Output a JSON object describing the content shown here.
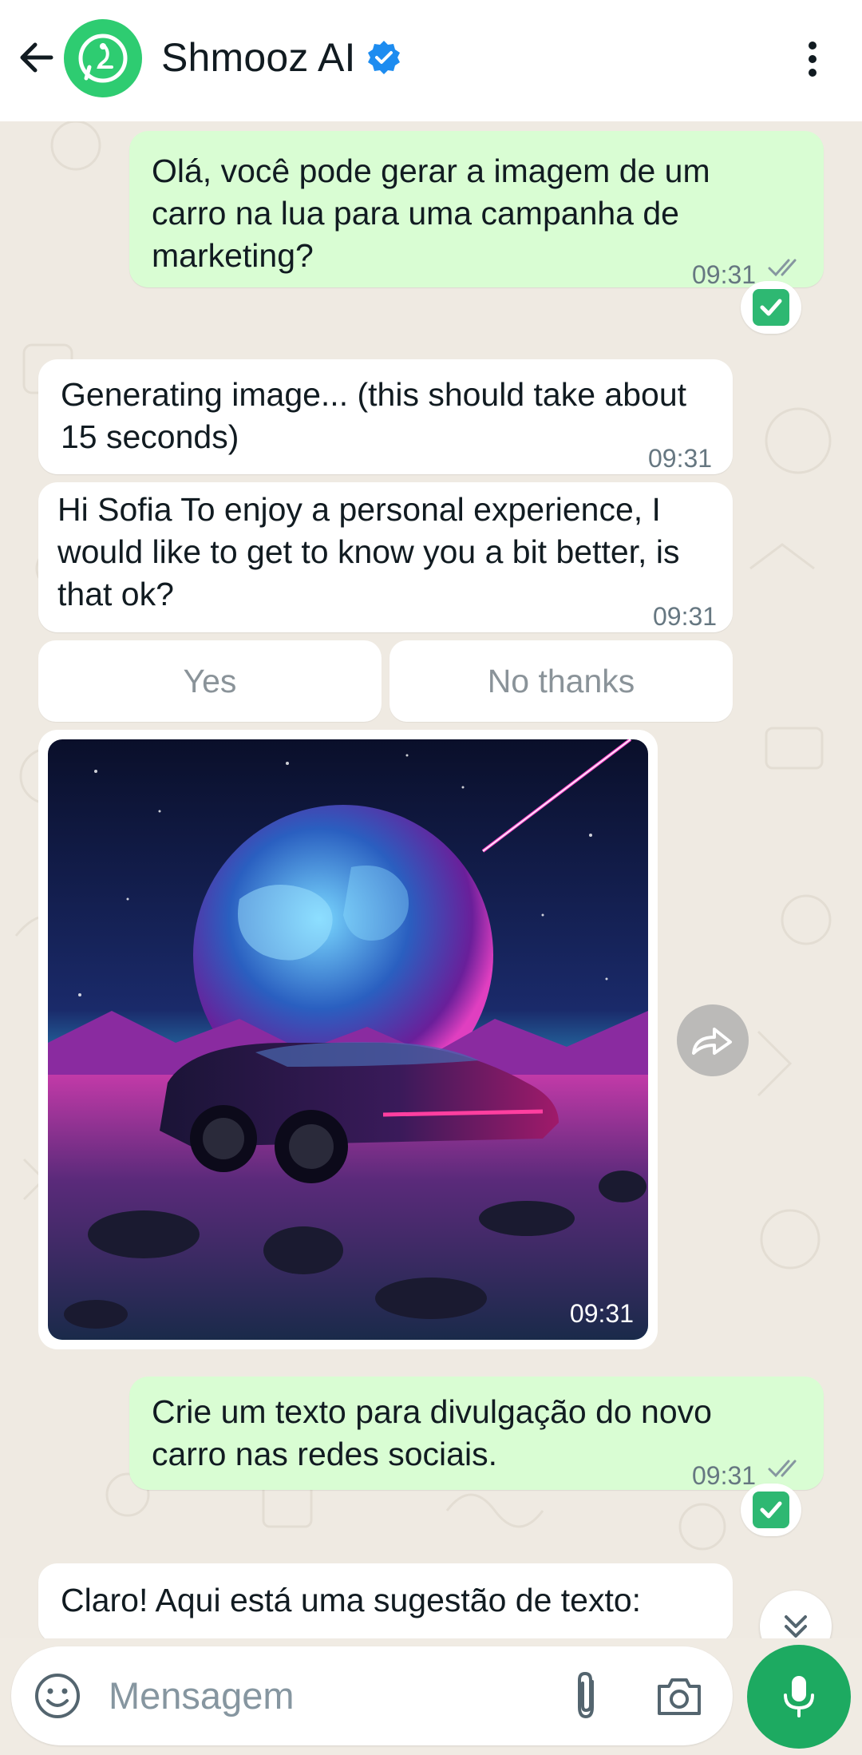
{
  "header": {
    "title": "Shmooz AI",
    "back_icon": "arrow-left-icon",
    "avatar_icon": "whatsapp-avatar-icon",
    "verified_icon": "verified-badge-icon",
    "menu_icon": "more-vert-icon"
  },
  "messages": [
    {
      "direction": "outgoing",
      "text": "Olá, você pode gerar a imagem de um carro na lua para uma campanha de marketing?",
      "time": "09:31",
      "status": "read",
      "reaction": "check-mark-icon"
    },
    {
      "direction": "incoming",
      "text": "Generating image... (this should take about 15 seconds)",
      "time": "09:31"
    },
    {
      "direction": "incoming",
      "text": "Hi Sofia To enjoy a personal experience, I would like to get to know you a bit better, is that ok?",
      "time": "09:31"
    },
    {
      "direction": "incoming",
      "type": "image",
      "time": "09:31"
    },
    {
      "direction": "outgoing",
      "text": "Crie um texto para divulgação do novo carro nas redes sociais.",
      "time": "09:31",
      "status": "read",
      "reaction": "check-mark-icon"
    },
    {
      "direction": "incoming",
      "text": "Claro! Aqui está uma sugestão de texto:"
    }
  ],
  "quick_replies": [
    "Yes",
    "No thanks"
  ],
  "composer": {
    "placeholder": "Mensagem"
  },
  "colors": {
    "header_bg": "#ffffff",
    "chat_bg": "#efeae2",
    "outgoing_bubble": "#d9fdd3",
    "incoming_bubble": "#ffffff",
    "accent_green": "#1daa61",
    "tick_read": "#8696a0"
  }
}
